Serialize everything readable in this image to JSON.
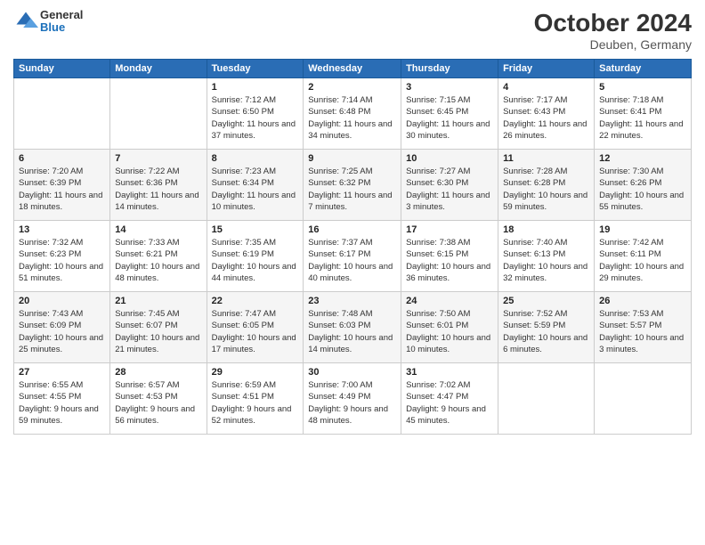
{
  "header": {
    "logo": {
      "general": "General",
      "blue": "Blue"
    },
    "title": "October 2024",
    "location": "Deuben, Germany"
  },
  "days_of_week": [
    "Sunday",
    "Monday",
    "Tuesday",
    "Wednesday",
    "Thursday",
    "Friday",
    "Saturday"
  ],
  "weeks": [
    [
      null,
      null,
      {
        "day": "1",
        "sunrise": "7:12 AM",
        "sunset": "6:50 PM",
        "daylight": "11 hours and 37 minutes."
      },
      {
        "day": "2",
        "sunrise": "7:14 AM",
        "sunset": "6:48 PM",
        "daylight": "11 hours and 34 minutes."
      },
      {
        "day": "3",
        "sunrise": "7:15 AM",
        "sunset": "6:45 PM",
        "daylight": "11 hours and 30 minutes."
      },
      {
        "day": "4",
        "sunrise": "7:17 AM",
        "sunset": "6:43 PM",
        "daylight": "11 hours and 26 minutes."
      },
      {
        "day": "5",
        "sunrise": "7:18 AM",
        "sunset": "6:41 PM",
        "daylight": "11 hours and 22 minutes."
      }
    ],
    [
      {
        "day": "6",
        "sunrise": "7:20 AM",
        "sunset": "6:39 PM",
        "daylight": "11 hours and 18 minutes."
      },
      {
        "day": "7",
        "sunrise": "7:22 AM",
        "sunset": "6:36 PM",
        "daylight": "11 hours and 14 minutes."
      },
      {
        "day": "8",
        "sunrise": "7:23 AM",
        "sunset": "6:34 PM",
        "daylight": "11 hours and 10 minutes."
      },
      {
        "day": "9",
        "sunrise": "7:25 AM",
        "sunset": "6:32 PM",
        "daylight": "11 hours and 7 minutes."
      },
      {
        "day": "10",
        "sunrise": "7:27 AM",
        "sunset": "6:30 PM",
        "daylight": "11 hours and 3 minutes."
      },
      {
        "day": "11",
        "sunrise": "7:28 AM",
        "sunset": "6:28 PM",
        "daylight": "10 hours and 59 minutes."
      },
      {
        "day": "12",
        "sunrise": "7:30 AM",
        "sunset": "6:26 PM",
        "daylight": "10 hours and 55 minutes."
      }
    ],
    [
      {
        "day": "13",
        "sunrise": "7:32 AM",
        "sunset": "6:23 PM",
        "daylight": "10 hours and 51 minutes."
      },
      {
        "day": "14",
        "sunrise": "7:33 AM",
        "sunset": "6:21 PM",
        "daylight": "10 hours and 48 minutes."
      },
      {
        "day": "15",
        "sunrise": "7:35 AM",
        "sunset": "6:19 PM",
        "daylight": "10 hours and 44 minutes."
      },
      {
        "day": "16",
        "sunrise": "7:37 AM",
        "sunset": "6:17 PM",
        "daylight": "10 hours and 40 minutes."
      },
      {
        "day": "17",
        "sunrise": "7:38 AM",
        "sunset": "6:15 PM",
        "daylight": "10 hours and 36 minutes."
      },
      {
        "day": "18",
        "sunrise": "7:40 AM",
        "sunset": "6:13 PM",
        "daylight": "10 hours and 32 minutes."
      },
      {
        "day": "19",
        "sunrise": "7:42 AM",
        "sunset": "6:11 PM",
        "daylight": "10 hours and 29 minutes."
      }
    ],
    [
      {
        "day": "20",
        "sunrise": "7:43 AM",
        "sunset": "6:09 PM",
        "daylight": "10 hours and 25 minutes."
      },
      {
        "day": "21",
        "sunrise": "7:45 AM",
        "sunset": "6:07 PM",
        "daylight": "10 hours and 21 minutes."
      },
      {
        "day": "22",
        "sunrise": "7:47 AM",
        "sunset": "6:05 PM",
        "daylight": "10 hours and 17 minutes."
      },
      {
        "day": "23",
        "sunrise": "7:48 AM",
        "sunset": "6:03 PM",
        "daylight": "10 hours and 14 minutes."
      },
      {
        "day": "24",
        "sunrise": "7:50 AM",
        "sunset": "6:01 PM",
        "daylight": "10 hours and 10 minutes."
      },
      {
        "day": "25",
        "sunrise": "7:52 AM",
        "sunset": "5:59 PM",
        "daylight": "10 hours and 6 minutes."
      },
      {
        "day": "26",
        "sunrise": "7:53 AM",
        "sunset": "5:57 PM",
        "daylight": "10 hours and 3 minutes."
      }
    ],
    [
      {
        "day": "27",
        "sunrise": "6:55 AM",
        "sunset": "4:55 PM",
        "daylight": "9 hours and 59 minutes."
      },
      {
        "day": "28",
        "sunrise": "6:57 AM",
        "sunset": "4:53 PM",
        "daylight": "9 hours and 56 minutes."
      },
      {
        "day": "29",
        "sunrise": "6:59 AM",
        "sunset": "4:51 PM",
        "daylight": "9 hours and 52 minutes."
      },
      {
        "day": "30",
        "sunrise": "7:00 AM",
        "sunset": "4:49 PM",
        "daylight": "9 hours and 48 minutes."
      },
      {
        "day": "31",
        "sunrise": "7:02 AM",
        "sunset": "4:47 PM",
        "daylight": "9 hours and 45 minutes."
      },
      null,
      null
    ]
  ]
}
